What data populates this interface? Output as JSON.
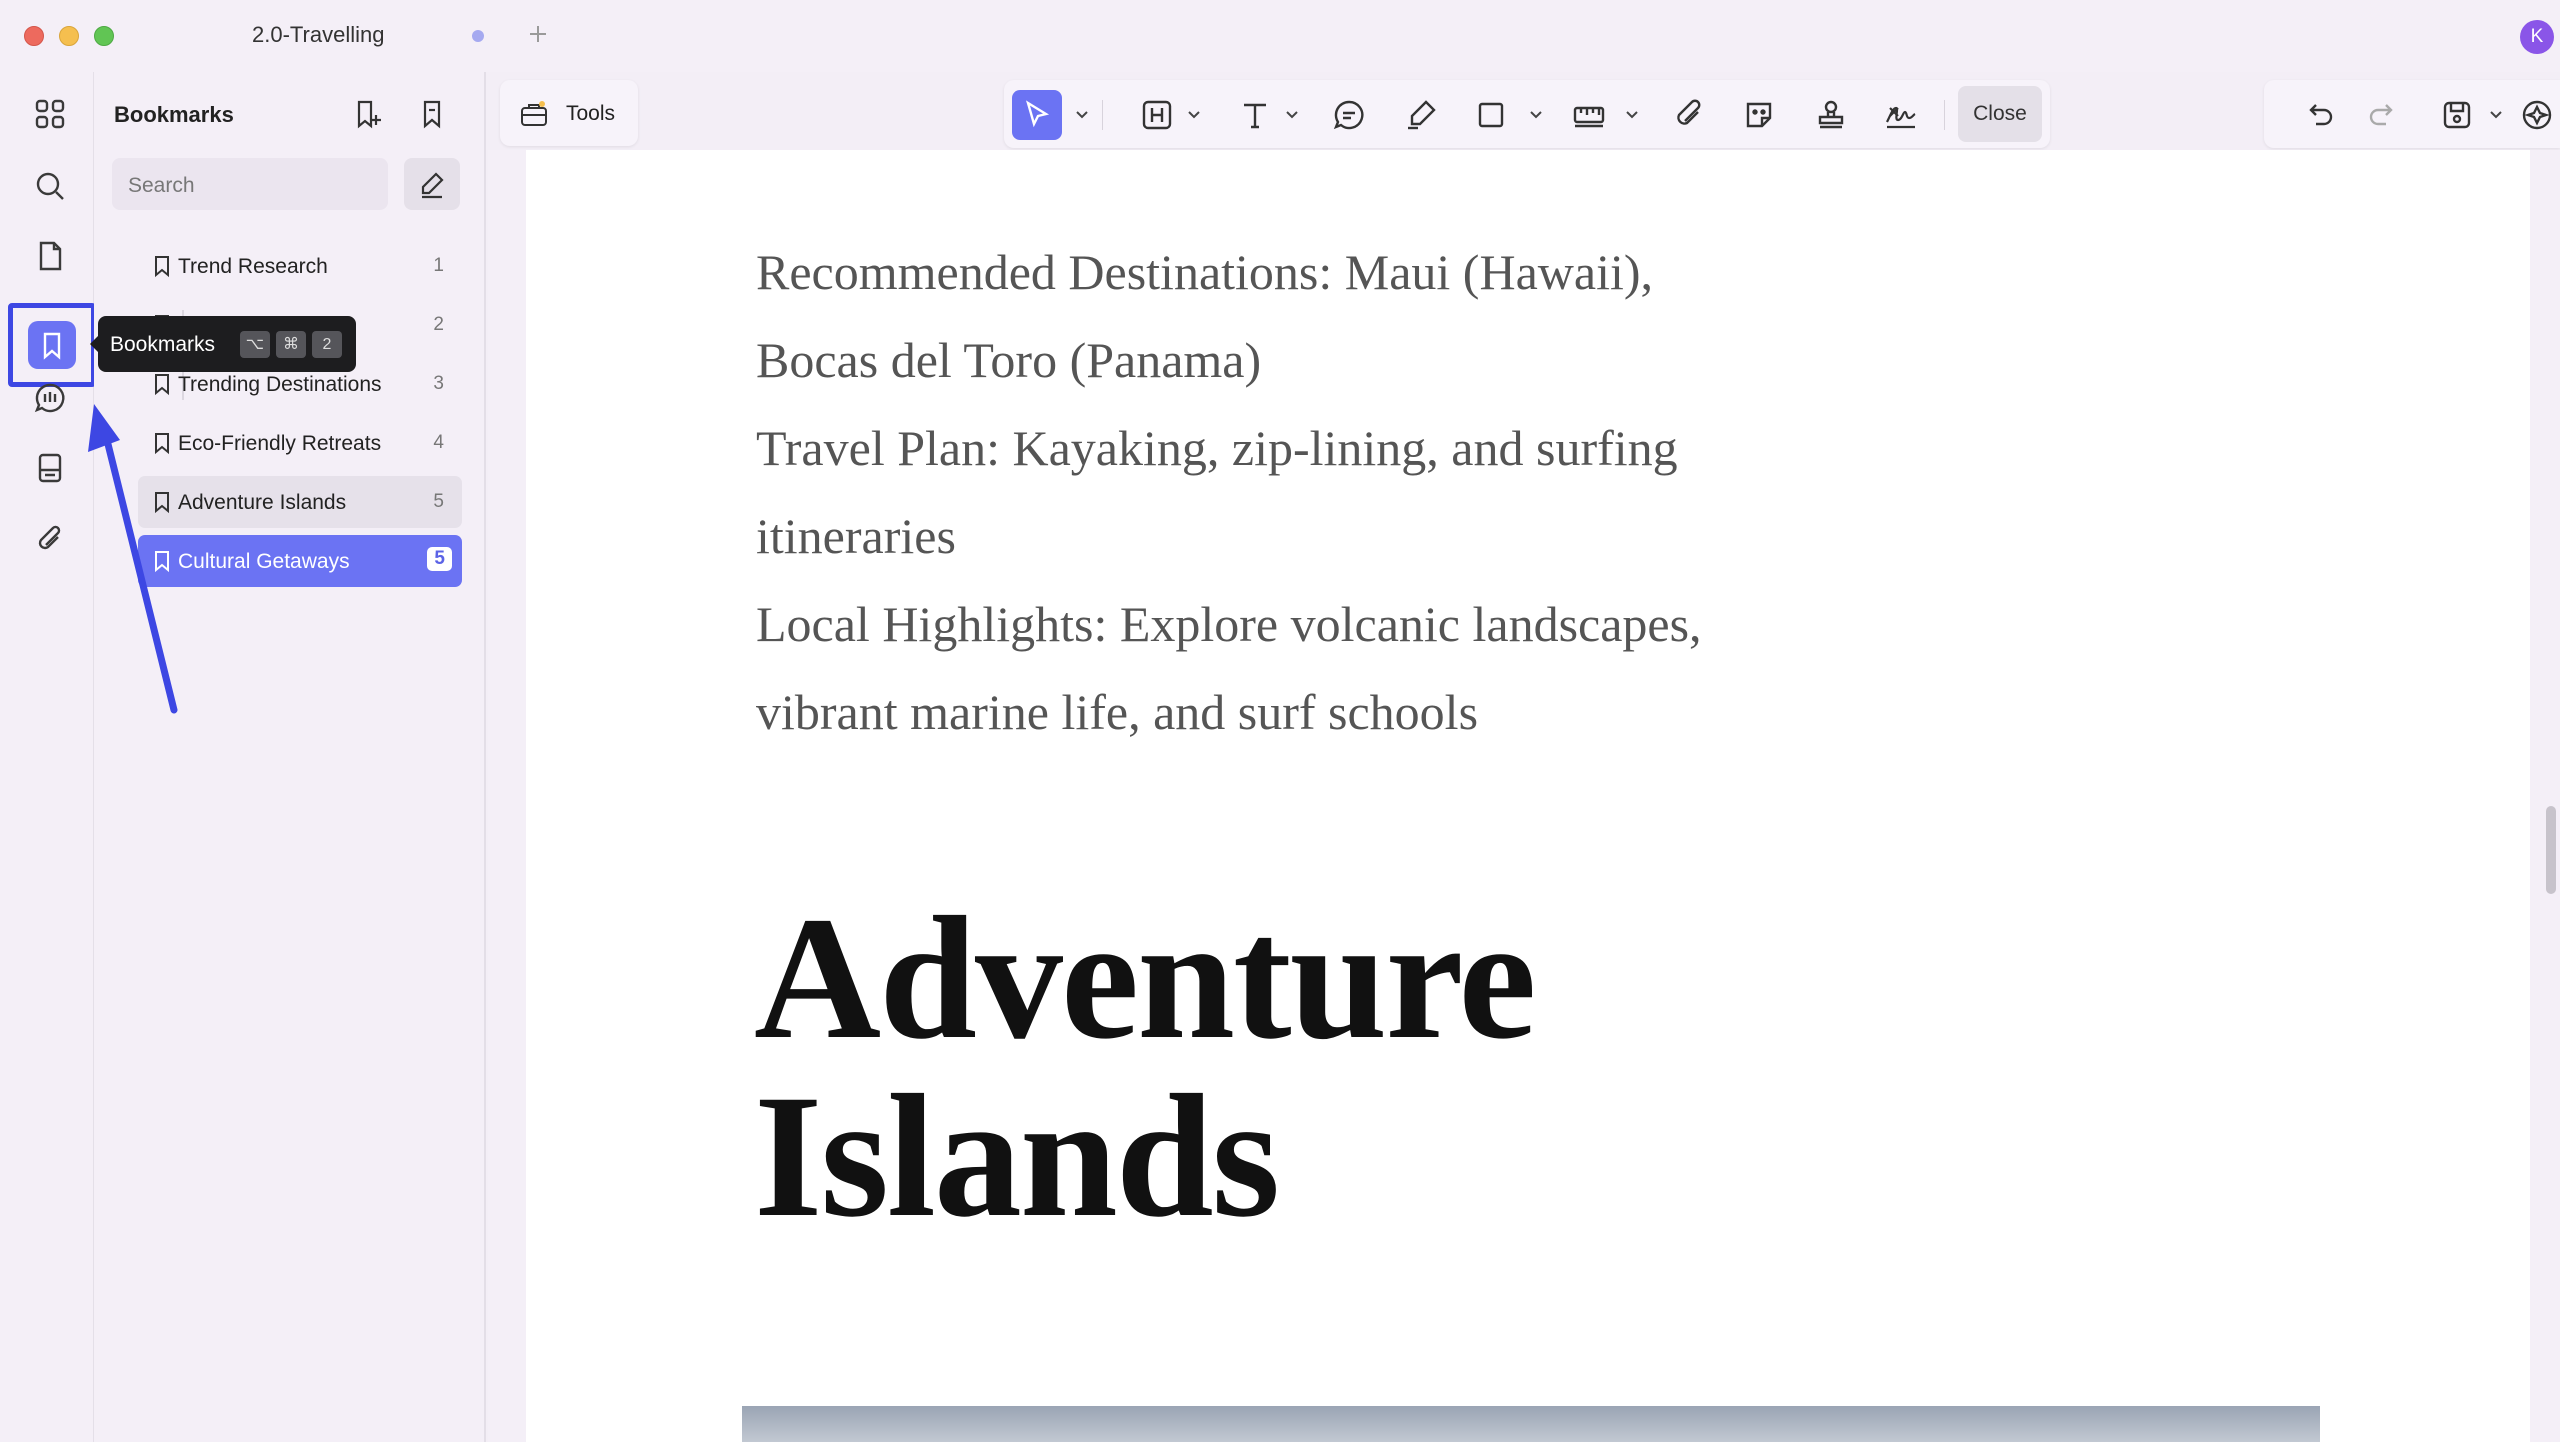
{
  "window": {
    "tab_title": "2.0-Travelling",
    "avatar_initial": "K"
  },
  "rail": {
    "items": [
      "apps-icon",
      "search-icon",
      "pages-icon",
      "bookmark-icon",
      "ai-assistant-icon",
      "stamp-tray-icon",
      "attachment-icon"
    ],
    "active": "bookmark-icon"
  },
  "bookmarks_panel": {
    "title": "Bookmarks",
    "search_placeholder": "Search",
    "items": [
      {
        "label": "Trend Research",
        "page": "1"
      },
      {
        "label": "",
        "page": "2"
      },
      {
        "label": "Trending Destinations",
        "page": "3"
      },
      {
        "label": "Eco-Friendly Retreats",
        "page": "4"
      },
      {
        "label": "Adventure Islands",
        "page": "5"
      },
      {
        "label": "Cultural Getaways",
        "page": "5"
      }
    ],
    "selected_index": 5
  },
  "tooltip": {
    "label": "Bookmarks",
    "keys": [
      "⌥",
      "⌘",
      "2"
    ]
  },
  "toolbar": {
    "tools_label": "Tools",
    "close_label": "Close"
  },
  "document": {
    "lines": [
      "Recommended Destinations: Maui (Hawaii),",
      "Bocas del Toro (Panama)",
      "Travel Plan: Kayaking, zip-lining, and surfing",
      "itineraries",
      "Local Highlights: Explore volcanic landscapes,",
      "vibrant marine life, and surf schools"
    ],
    "heading_line1": "Adventure",
    "heading_line2": "Islands"
  },
  "colors": {
    "accent": "#6b73f3",
    "annotation": "#3d47e3"
  }
}
